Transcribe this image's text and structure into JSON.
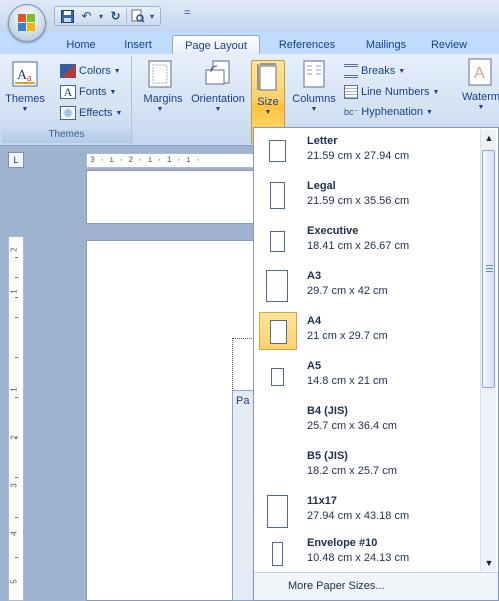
{
  "qat": {
    "more": "="
  },
  "tabs": [
    {
      "label": "Home",
      "active": false
    },
    {
      "label": "Insert",
      "active": false
    },
    {
      "label": "Page Layout",
      "active": true
    },
    {
      "label": "References",
      "active": false
    },
    {
      "label": "Mailings",
      "active": false
    },
    {
      "label": "Review",
      "active": false
    }
  ],
  "ribbon": {
    "themes_group": {
      "themes_label": "Themes",
      "colors_label": "Colors",
      "fonts_label": "Fonts",
      "effects_label": "Effects",
      "group_label": "Themes"
    },
    "page_setup": {
      "margins_label": "Margins",
      "orientation_label": "Orientation",
      "size_label": "Size",
      "columns_label": "Columns",
      "breaks_label": "Breaks",
      "line_numbers_label": "Line Numbers",
      "hyphenation_label": "Hyphenation"
    },
    "watermark_label": "Waterm"
  },
  "ruler": {
    "corner": "L",
    "horizontal_text": "3 · ı · 2 · ı · 1 · ı ·",
    "vertical_numbers": [
      "2",
      "1",
      "1",
      "2",
      "3",
      "4",
      "5"
    ]
  },
  "doc": {
    "dialog_fragment": "Pa"
  },
  "size_gallery": {
    "items": [
      {
        "name": "Letter",
        "dims": "21.59 cm x 27.94 cm",
        "selected": false
      },
      {
        "name": "Legal",
        "dims": "21.59 cm x 35.56 cm",
        "selected": false
      },
      {
        "name": "Executive",
        "dims": "18.41 cm x 26.67 cm",
        "selected": false
      },
      {
        "name": "A3",
        "dims": "29.7 cm x 42 cm",
        "selected": false
      },
      {
        "name": "A4",
        "dims": "21 cm x 29.7 cm",
        "selected": true
      },
      {
        "name": "A5",
        "dims": "14.8 cm x 21 cm",
        "selected": false
      },
      {
        "name": "B4 (JIS)",
        "dims": "25.7 cm x 36.4 cm",
        "selected": false
      },
      {
        "name": "B5 (JIS)",
        "dims": "18.2 cm x 25.7 cm",
        "selected": false
      },
      {
        "name": "11x17",
        "dims": "27.94 cm x 43.18 cm",
        "selected": false
      },
      {
        "name": "Envelope #10",
        "dims": "10.48 cm x 24.13 cm",
        "selected": false
      }
    ],
    "more_label": "More Paper Sizes..."
  },
  "colors": {
    "accent": "#15428b",
    "selection": "#ffd065"
  }
}
